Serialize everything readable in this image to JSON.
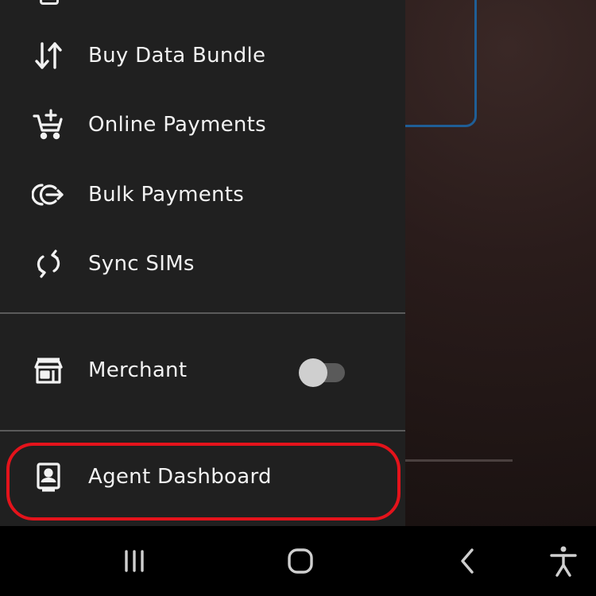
{
  "drawer": {
    "items": [
      {
        "label": "Buy Data Bundle",
        "icon": "arrows-up-down-icon"
      },
      {
        "label": "Online Payments",
        "icon": "cart-add-icon"
      },
      {
        "label": "Bulk Payments",
        "icon": "bulk-send-icon"
      },
      {
        "label": "Sync SIMs",
        "icon": "sync-icon"
      }
    ],
    "merchant": {
      "label": "Merchant",
      "icon": "store-icon",
      "toggle_on": false
    },
    "agent": {
      "label": "Agent Dashboard",
      "icon": "contact-badge-icon"
    }
  },
  "colors": {
    "drawer_bg": "#202020",
    "highlight": "#e4131b",
    "backdrop_accent": "#1f5e96"
  },
  "navbar": {
    "buttons": [
      "recent-apps-icon",
      "home-icon",
      "back-icon",
      "accessibility-icon"
    ]
  }
}
